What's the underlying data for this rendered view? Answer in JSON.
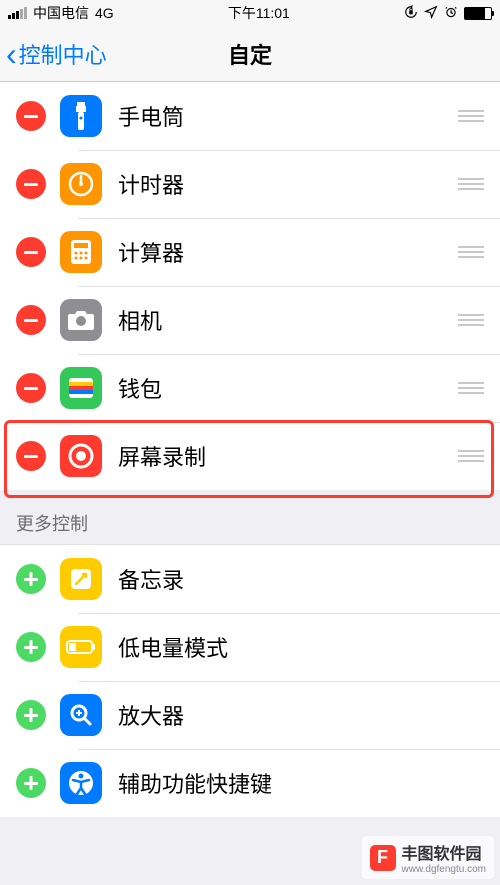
{
  "status": {
    "carrier": "中国电信",
    "network": "4G",
    "time": "下午11:01"
  },
  "nav": {
    "back_label": "控制中心",
    "title": "自定"
  },
  "included": [
    {
      "icon": "flashlight-icon",
      "label": "手电筒"
    },
    {
      "icon": "timer-icon",
      "label": "计时器"
    },
    {
      "icon": "calculator-icon",
      "label": "计算器"
    },
    {
      "icon": "camera-icon",
      "label": "相机"
    },
    {
      "icon": "wallet-icon",
      "label": "钱包"
    },
    {
      "icon": "screen-recording-icon",
      "label": "屏幕录制"
    }
  ],
  "more_section_title": "更多控制",
  "more": [
    {
      "icon": "notes-icon",
      "label": "备忘录"
    },
    {
      "icon": "low-power-icon",
      "label": "低电量模式"
    },
    {
      "icon": "magnifier-icon",
      "label": "放大器"
    },
    {
      "icon": "accessibility-icon",
      "label": "辅助功能快捷键"
    }
  ],
  "highlighted_row_index": 5,
  "watermark": {
    "brand": "丰图软件园",
    "url": "www.dgfengtu.com"
  }
}
